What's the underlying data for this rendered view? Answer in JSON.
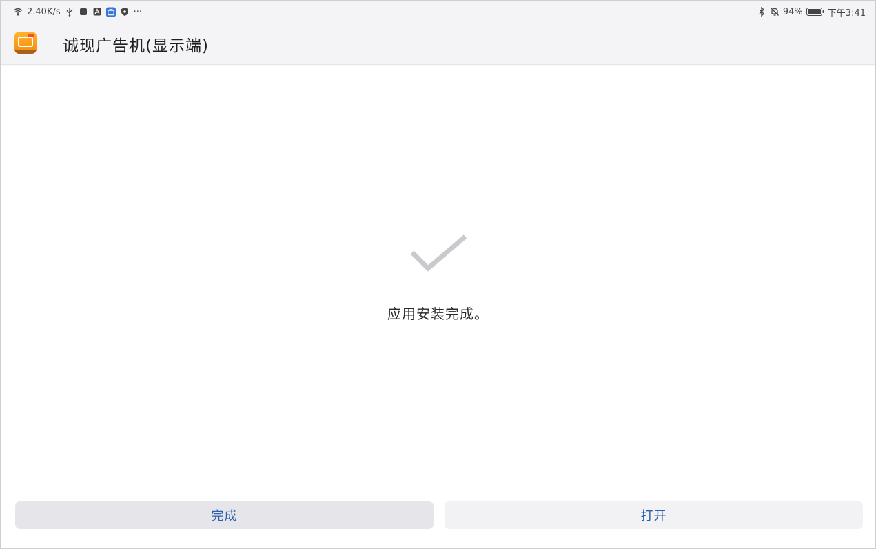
{
  "status_bar": {
    "network_speed": "2.40K/s",
    "more_indicator": "···",
    "battery_percent": "94%",
    "time": "下午3:41",
    "icons": [
      "wifi-icon",
      "usb-icon",
      "square-icon",
      "a-badge-icon",
      "store-icon",
      "shield-icon",
      "bluetooth-icon",
      "mute-bell-icon",
      "battery-icon"
    ]
  },
  "toolbar": {
    "app_title": "诚现广告机(显示端)",
    "app_icon": "app-logo-icon"
  },
  "main": {
    "message": "应用安装完成。",
    "check_color": "#c9c9ce"
  },
  "buttons": {
    "done_label": "完成",
    "open_label": "打开",
    "label_color": "#2f5fb0"
  }
}
